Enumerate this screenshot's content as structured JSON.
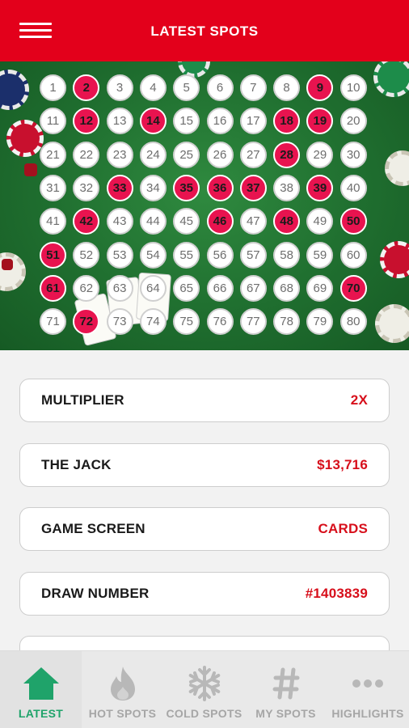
{
  "header": {
    "title": "LATEST SPOTS",
    "menu_icon": "hamburger-menu-icon"
  },
  "board": {
    "numbers": [
      1,
      2,
      3,
      4,
      5,
      6,
      7,
      8,
      9,
      10,
      11,
      12,
      13,
      14,
      15,
      16,
      17,
      18,
      19,
      20,
      21,
      22,
      23,
      24,
      25,
      26,
      27,
      28,
      29,
      30,
      31,
      32,
      33,
      34,
      35,
      36,
      37,
      38,
      39,
      40,
      41,
      42,
      43,
      44,
      45,
      46,
      47,
      48,
      49,
      50,
      51,
      52,
      53,
      54,
      55,
      56,
      57,
      58,
      59,
      60,
      61,
      62,
      63,
      64,
      65,
      66,
      67,
      68,
      69,
      70,
      71,
      72,
      73,
      74,
      75,
      76,
      77,
      78,
      79,
      80
    ],
    "drawn": [
      2,
      9,
      12,
      14,
      18,
      19,
      28,
      33,
      35,
      36,
      37,
      39,
      42,
      46,
      48,
      50,
      51,
      61,
      70,
      72
    ],
    "colors": {
      "drawn": "#e8134f",
      "undrawn": "#ffffff",
      "felt": "#1f6e2f"
    }
  },
  "info": [
    {
      "label": "MULTIPLIER",
      "value": "2X"
    },
    {
      "label": "THE JACK",
      "value": "$13,716"
    },
    {
      "label": "GAME SCREEN",
      "value": "CARDS"
    },
    {
      "label": "DRAW NUMBER",
      "value": "#1403839"
    }
  ],
  "tabs": [
    {
      "label": "LATEST",
      "icon": "home-icon",
      "active": true
    },
    {
      "label": "HOT SPOTS",
      "icon": "flame-icon",
      "active": false
    },
    {
      "label": "COLD SPOTS",
      "icon": "snowflake-icon",
      "active": false
    },
    {
      "label": "MY SPOTS",
      "icon": "hash-icon",
      "active": false
    },
    {
      "label": "HIGHLIGHTS",
      "icon": "more-dots-icon",
      "active": false
    }
  ],
  "colors": {
    "brand_red": "#e3001b",
    "accent_green": "#1fa36a",
    "value_red": "#d70f1b"
  }
}
